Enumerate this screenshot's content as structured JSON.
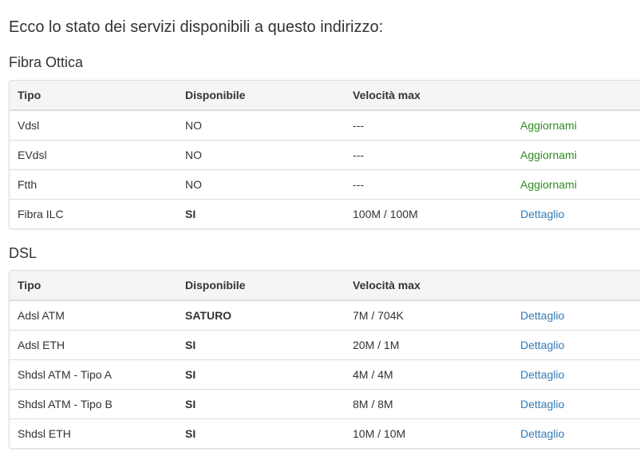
{
  "intro": "Ecco lo stato dei servizi disponibili a questo indirizzo:",
  "colors": {
    "upgrade_link": "#2e8b22",
    "detail_link": "#337ab7"
  },
  "sections": [
    {
      "title": "Fibra Ottica",
      "headers": [
        "Tipo",
        "Disponibile",
        "Velocità max",
        ""
      ],
      "rows": [
        {
          "tipo": "Vdsl",
          "disponibile": "NO",
          "velocita": "---",
          "action": "Aggiornami"
        },
        {
          "tipo": "EVdsl",
          "disponibile": "NO",
          "velocita": "---",
          "action": "Aggiornami"
        },
        {
          "tipo": "Ftth",
          "disponibile": "NO",
          "velocita": "---",
          "action": "Aggiornami"
        },
        {
          "tipo": "Fibra ILC",
          "disponibile": "SI",
          "velocita": "100M / 100M",
          "action": "Dettaglio"
        }
      ]
    },
    {
      "title": "DSL",
      "headers": [
        "Tipo",
        "Disponibile",
        "Velocità max",
        ""
      ],
      "rows": [
        {
          "tipo": "Adsl ATM",
          "disponibile": "SATURO",
          "velocita": "7M / 704K",
          "action": "Dettaglio"
        },
        {
          "tipo": "Adsl ETH",
          "disponibile": "SI",
          "velocita": "20M / 1M",
          "action": "Dettaglio"
        },
        {
          "tipo": "Shdsl ATM - Tipo A",
          "disponibile": "SI",
          "velocita": "4M / 4M",
          "action": "Dettaglio"
        },
        {
          "tipo": "Shdsl ATM - Tipo B",
          "disponibile": "SI",
          "velocita": "8M / 8M",
          "action": "Dettaglio"
        },
        {
          "tipo": "Shdsl ETH",
          "disponibile": "SI",
          "velocita": "10M / 10M",
          "action": "Dettaglio"
        }
      ]
    }
  ]
}
